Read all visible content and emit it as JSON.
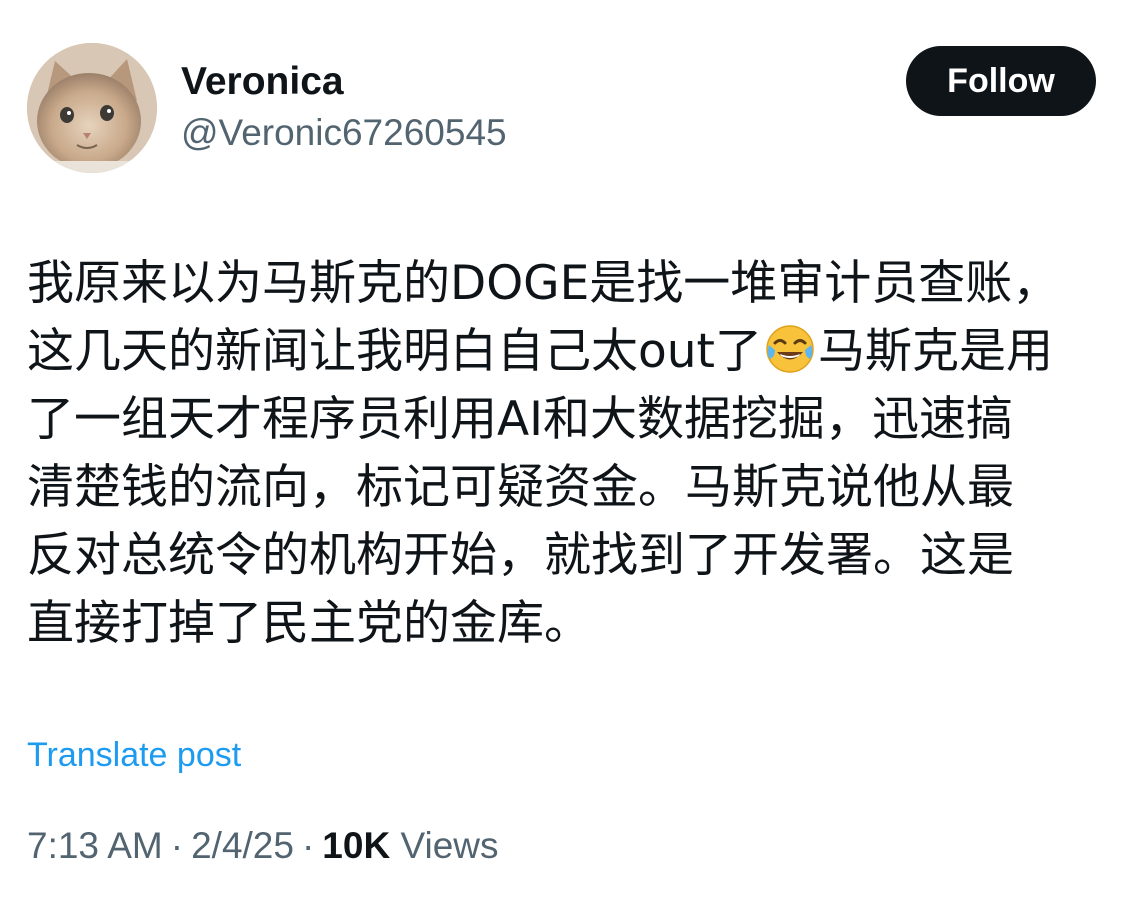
{
  "author": {
    "display_name": "Veronica",
    "handle": "@Veronic67260545",
    "avatar_icon": "cat-avatar"
  },
  "actions": {
    "follow_label": "Follow"
  },
  "post": {
    "lines": [
      "我原来以为马斯克的DOGE是找一堆审计员查账，",
      "这几天的新闻让我明白自己太out了",
      "马斯克是用",
      "了一组天才程序员利用AI和大数据挖掘，迅速搞",
      "清楚钱的流向，标记可疑资金。马斯克说他从最",
      "反对总统令的机构开始，就找到了开发署。这是",
      "直接打掉了民主党的金库。"
    ],
    "emoji": "face-with-tears-of-joy"
  },
  "translate_label": "Translate post",
  "meta": {
    "time": "7:13 AM",
    "date": "2/4/25",
    "views_count": "10K",
    "views_label": "Views",
    "separator": "·"
  },
  "colors": {
    "text_primary": "#0f1419",
    "text_secondary": "#536471",
    "link": "#1d9bf0",
    "button_bg": "#0f1419",
    "button_text": "#ffffff"
  }
}
